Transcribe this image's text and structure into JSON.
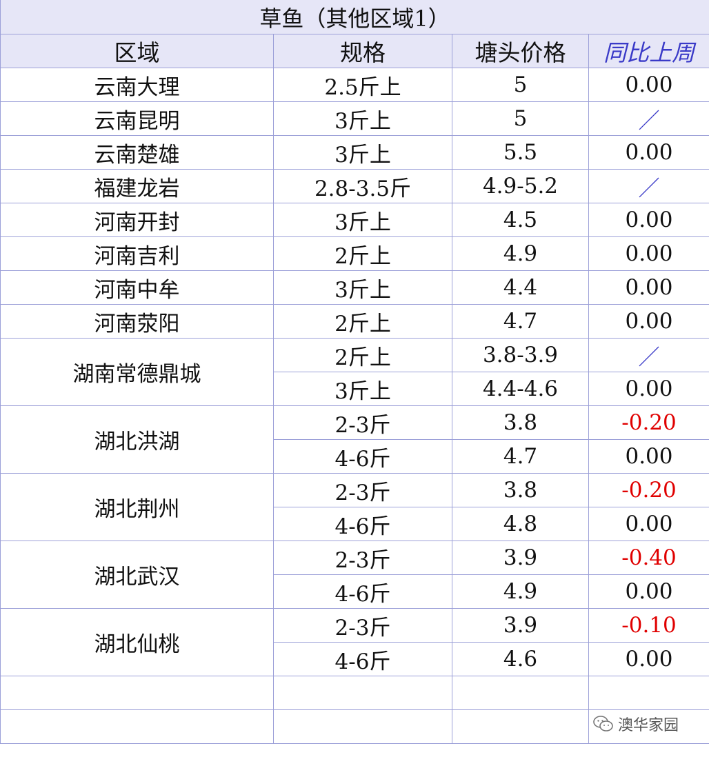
{
  "title": "草鱼（其他区域1）",
  "headers": {
    "region": "区域",
    "spec": "规格",
    "price": "塘头价格",
    "yoy": "同比上周"
  },
  "rows": [
    {
      "region": "云南大理",
      "spec": "2.5斤上",
      "price": "5",
      "yoy": "0.00"
    },
    {
      "region": "云南昆明",
      "spec": "3斤上",
      "price": "5",
      "yoy": "／"
    },
    {
      "region": "云南楚雄",
      "spec": "3斤上",
      "price": "5.5",
      "yoy": "0.00"
    },
    {
      "region": "福建龙岩",
      "spec": "2.8-3.5斤",
      "price": "4.9-5.2",
      "yoy": "／"
    },
    {
      "region": "河南开封",
      "spec": "3斤上",
      "price": "4.5",
      "yoy": "0.00"
    },
    {
      "region": "河南吉利",
      "spec": "2斤上",
      "price": "4.9",
      "yoy": "0.00"
    },
    {
      "region": "河南中牟",
      "spec": "3斤上",
      "price": "4.4",
      "yoy": "0.00"
    },
    {
      "region": "河南荥阳",
      "spec": "2斤上",
      "price": "4.7",
      "yoy": "0.00"
    }
  ],
  "groups": [
    {
      "region": "湖南常德鼎城",
      "rows": [
        {
          "spec": "2斤上",
          "price": "3.8-3.9",
          "yoy": "／"
        },
        {
          "spec": "3斤上",
          "price": "4.4-4.6",
          "yoy": "0.00"
        }
      ]
    },
    {
      "region": "湖北洪湖",
      "rows": [
        {
          "spec": "2-3斤",
          "price": "3.8",
          "yoy": "-0.20"
        },
        {
          "spec": "4-6斤",
          "price": "4.7",
          "yoy": "0.00"
        }
      ]
    },
    {
      "region": "湖北荆州",
      "rows": [
        {
          "spec": "2-3斤",
          "price": "3.8",
          "yoy": "-0.20"
        },
        {
          "spec": "4-6斤",
          "price": "4.8",
          "yoy": "0.00"
        }
      ]
    },
    {
      "region": "湖北武汉",
      "rows": [
        {
          "spec": "2-3斤",
          "price": "3.9",
          "yoy": "-0.40"
        },
        {
          "spec": "4-6斤",
          "price": "4.9",
          "yoy": "0.00"
        }
      ]
    },
    {
      "region": "湖北仙桃",
      "rows": [
        {
          "spec": "2-3斤",
          "price": "3.9",
          "yoy": "-0.10"
        },
        {
          "spec": "4-6斤",
          "price": "4.6",
          "yoy": "0.00"
        }
      ]
    }
  ],
  "colors": {
    "header_bg": "#e6e6f7",
    "grid": "#9b9fd8",
    "negative": "#e00000",
    "accent_blue": "#3a3ac8"
  },
  "watermark": {
    "icon": "wechat-icon",
    "text": "澳华家园"
  }
}
